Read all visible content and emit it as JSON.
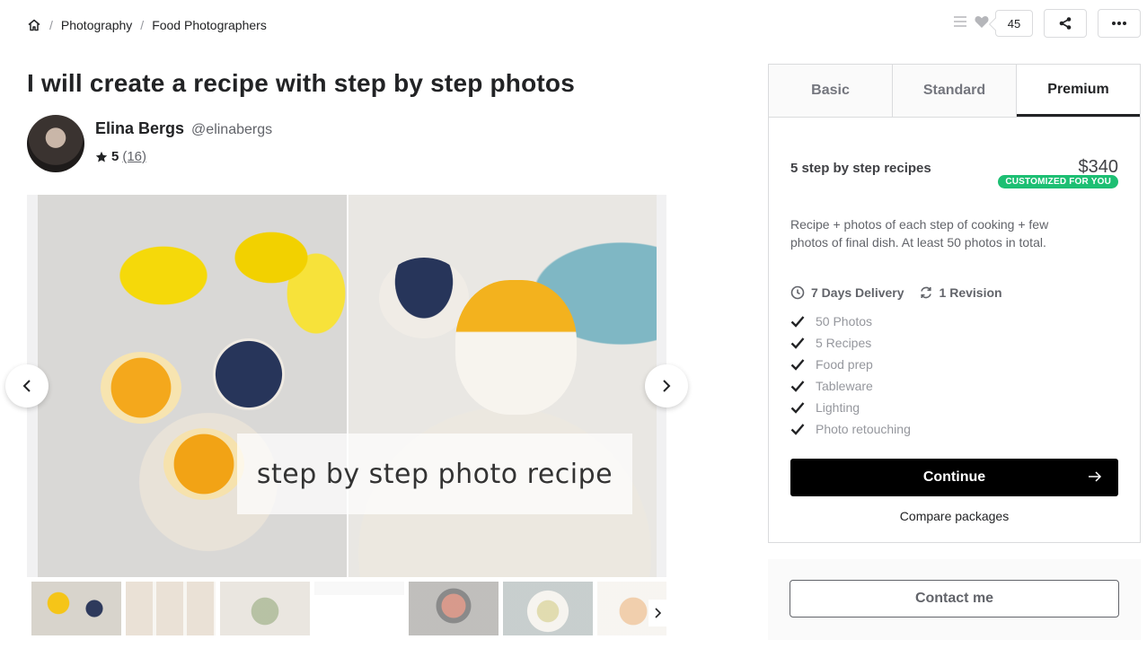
{
  "breadcrumb": {
    "home_icon": "home-icon",
    "items": [
      "Photography",
      "Food Photographers"
    ]
  },
  "top_actions": {
    "collections_count": "45",
    "icons": [
      "list-icon",
      "heart-icon",
      "share-icon",
      "more-icon"
    ]
  },
  "gig": {
    "title": "I will create a recipe with step by step photos"
  },
  "seller": {
    "name": "Elina Bergs",
    "handle": "@elinabergs",
    "rating": "5",
    "reviews": "(16)"
  },
  "gallery": {
    "caption": "step by step photo recipe",
    "thumbnail_count": 7
  },
  "packages": {
    "tabs": [
      "Basic",
      "Standard",
      "Premium"
    ],
    "active_tab": "Premium",
    "badge": "CUSTOMIZED FOR YOU",
    "name": "5 step by step recipes",
    "price": "$340",
    "description": "Recipe + photos of each step of cooking + few photos of final dish. At least 50 photos in total.",
    "delivery": "7 Days Delivery",
    "revisions": "1 Revision",
    "features": [
      "50 Photos",
      "5 Recipes",
      "Food prep",
      "Tableware",
      "Lighting",
      "Photo retouching"
    ],
    "continue_label": "Continue",
    "compare_label": "Compare packages"
  },
  "contact": {
    "label": "Contact me"
  },
  "colors": {
    "accent_green": "#1dbf73",
    "primary_button": "#000000"
  }
}
